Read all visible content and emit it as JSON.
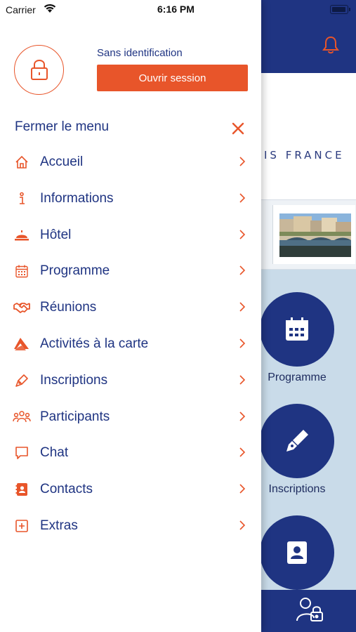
{
  "status_bar": {
    "carrier": "Carrier",
    "time": "6:16 PM"
  },
  "colors": {
    "accent_orange": "#e8552a",
    "brand_navy": "#1f3482",
    "background_light_blue": "#c9dbe9"
  },
  "drawer": {
    "user_status": "Sans identification",
    "login_button": "Ouvrir session",
    "close_menu_label": "Fermer le menu",
    "items": [
      {
        "label": "Accueil",
        "icon": "home-icon"
      },
      {
        "label": "Informations",
        "icon": "info-icon"
      },
      {
        "label": "Hôtel",
        "icon": "hotel-bell-icon"
      },
      {
        "label": "Programme",
        "icon": "calendar-icon"
      },
      {
        "label": "Réunions",
        "icon": "handshake-icon"
      },
      {
        "label": "Activités à la carte",
        "icon": "activities-icon"
      },
      {
        "label": "Inscriptions",
        "icon": "pen-icon"
      },
      {
        "label": "Participants",
        "icon": "group-icon"
      },
      {
        "label": "Chat",
        "icon": "chat-icon"
      },
      {
        "label": "Contacts",
        "icon": "contact-book-icon"
      },
      {
        "label": "Extras",
        "icon": "plus-box-icon"
      }
    ]
  },
  "background_app": {
    "banner_text": "IS FRANCE",
    "shortcuts": [
      {
        "label": "Programme",
        "icon": "calendar-icon"
      },
      {
        "label": "Inscriptions",
        "icon": "pen-icon"
      },
      {
        "label": "",
        "icon": "contact-book-icon"
      }
    ]
  }
}
